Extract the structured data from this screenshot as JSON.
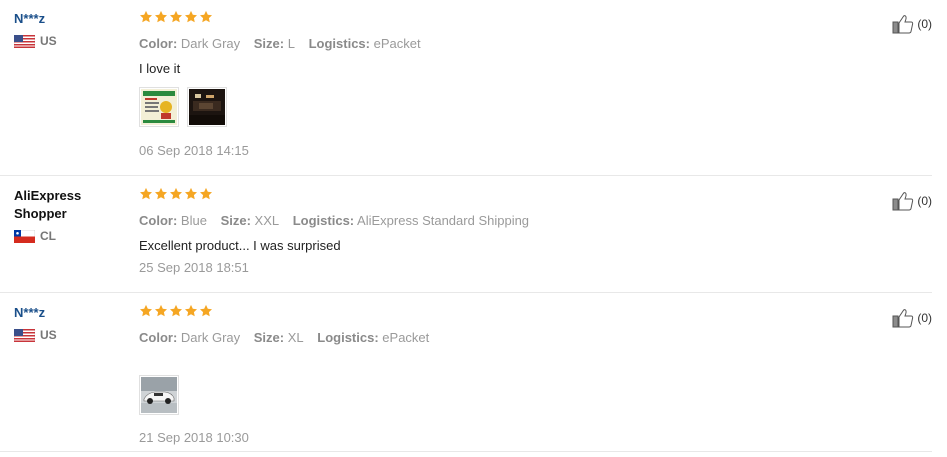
{
  "reviews": [
    {
      "user": "N***z",
      "country": "US",
      "attributes": [
        {
          "label": "Color:",
          "value": "Dark Gray"
        },
        {
          "label": "Size:",
          "value": "L"
        },
        {
          "label": "Logistics:",
          "value": "ePacket"
        }
      ],
      "text": "I love it",
      "date": "06 Sep 2018 14:15",
      "helpful": "(0)",
      "photos": [
        "photo-card-icon",
        "photo-dark-room-icon"
      ]
    },
    {
      "user": "AliExpress Shopper",
      "country": "CL",
      "attributes": [
        {
          "label": "Color:",
          "value": "Blue"
        },
        {
          "label": "Size:",
          "value": "XXL"
        },
        {
          "label": "Logistics:",
          "value": "AliExpress Standard Shipping"
        }
      ],
      "text": "Excellent product... I was surprised",
      "date": "25 Sep 2018 18:51",
      "helpful": "(0)",
      "photos": []
    },
    {
      "user": "N***z",
      "country": "US",
      "attributes": [
        {
          "label": "Color:",
          "value": "Dark Gray"
        },
        {
          "label": "Size:",
          "value": "XL"
        },
        {
          "label": "Logistics:",
          "value": "ePacket"
        }
      ],
      "text": "",
      "date": "21 Sep 2018 10:30",
      "helpful": "(0)",
      "photos": [
        "photo-white-car-icon"
      ]
    }
  ],
  "rating": {
    "stars": 5,
    "out_of": 5
  },
  "colors": {
    "star": "#f5a623",
    "user_link": "#1a4f8a",
    "muted": "#9a9a9a"
  }
}
